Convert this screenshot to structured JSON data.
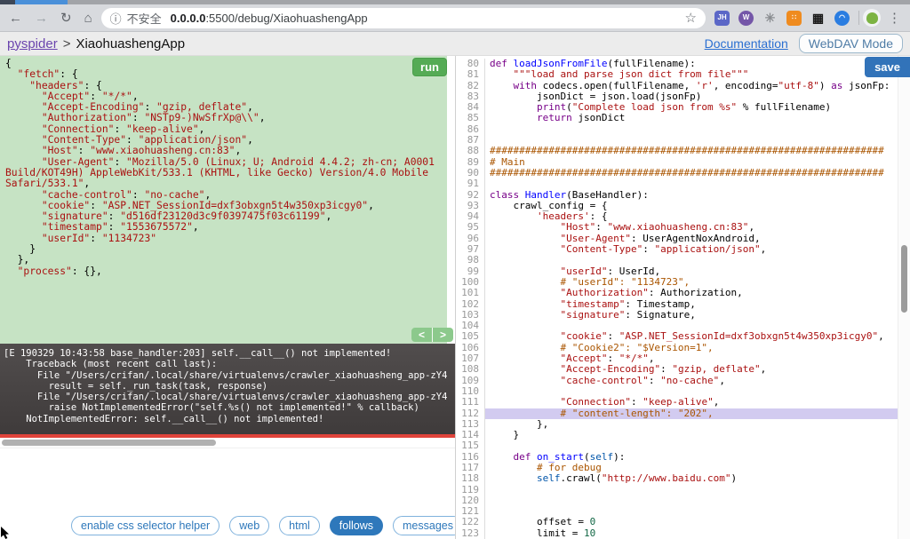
{
  "browser": {
    "icons": {
      "back": "←",
      "forward": "→",
      "reload": "↻",
      "home": "⌂",
      "info": "ⓘ",
      "star": "☆",
      "menu": "⋮"
    },
    "not_secure_label": "不安全",
    "url_host": "0.0.0.0",
    "url_path": ":5500/debug/XiaohuashengApp",
    "extensions": [
      {
        "name": "jh-extension-icon",
        "glyph": "JH",
        "bg": "#5b67c7",
        "fg": "#ffffff",
        "shape": "square"
      },
      {
        "name": "w-extension-icon",
        "glyph": "W",
        "bg": "#7456a8",
        "fg": "#ffffff",
        "shape": "circle"
      },
      {
        "name": "snowflake-extension-icon",
        "glyph": "✳",
        "bg": "transparent",
        "fg": "#8a8d91",
        "shape": "none"
      },
      {
        "name": "orange-grid-extension-icon",
        "glyph": "∷",
        "bg": "#ef8b1f",
        "fg": "#ffffff",
        "shape": "square"
      },
      {
        "name": "qr-code-extension-icon",
        "glyph": "▦",
        "bg": "transparent",
        "fg": "#1a1a1a",
        "shape": "none"
      },
      {
        "name": "blue-globe-extension-icon",
        "glyph": "◠",
        "bg": "#2a7de1",
        "fg": "#ffffff",
        "shape": "circle"
      }
    ]
  },
  "header": {
    "brand": "pyspider",
    "separator": ">",
    "project": "XiaohuashengApp",
    "doc_link": "Documentation",
    "webdav_button": "WebDAV Mode"
  },
  "task_panel": {
    "run_label": "run",
    "nav_prev": "<",
    "nav_next": ">",
    "json_text": "{\n  \"fetch\": {\n    \"headers\": {\n      \"Accept\": \"*/*\",\n      \"Accept-Encoding\": \"gzip, deflate\",\n      \"Authorization\": \"NSTp9-)NwSfrXp@\\\\\",\n      \"Connection\": \"keep-alive\",\n      \"Content-Type\": \"application/json\",\n      \"Host\": \"www.xiaohuasheng.cn:83\",\n      \"User-Agent\": \"Mozilla/5.0 (Linux; U; Android 4.4.2; zh-cn; A0001 Build/KOT49H) AppleWebKit/533.1 (KHTML, like Gecko) Version/4.0 Mobile Safari/533.1\",\n      \"cache-control\": \"no-cache\",\n      \"cookie\": \"ASP.NET_SessionId=dxf3obxgn5t4w350xp3icgy0\",\n      \"signature\": \"d516df23120d3c9f0397475f03c61199\",\n      \"timestamp\": \"1553675572\",\n      \"userId\": \"1134723\"\n    }\n  },\n  \"process\": {},"
  },
  "console": {
    "lines": [
      "[E 190329 10:43:58 base_handler:203] self.__call__() not implemented!",
      "    Traceback (most recent call last):",
      "      File \"/Users/crifan/.local/share/virtualenvs/crawler_xiaohuasheng_app-zY4",
      "        result = self._run_task(task, response)",
      "      File \"/Users/crifan/.local/share/virtualenvs/crawler_xiaohuasheng_app-zY4",
      "        raise NotImplementedError(\"self.%s() not implemented!\" % callback)",
      "    NotImplementedError: self.__call__() not implemented!"
    ]
  },
  "editor": {
    "save_label": "save",
    "first_line": 80,
    "highlight_line": 112,
    "lines": [
      [
        [
          "kw",
          "def"
        ],
        [
          "p",
          " "
        ],
        [
          "fn",
          "loadJsonFromFile"
        ],
        [
          "p",
          "(fullFilename):"
        ]
      ],
      [
        [
          "tk-str-x",
          ""
        ],
        [
          "str",
          "    \"\"\"load and parse json dict from file\"\"\""
        ]
      ],
      [
        [
          "p",
          "    "
        ],
        [
          "kw",
          "with"
        ],
        [
          "p",
          " codecs.open(fullFilename, "
        ],
        [
          "str",
          "'r'"
        ],
        [
          "p",
          ", encoding="
        ],
        [
          "str",
          "\"utf-8\""
        ],
        [
          "p",
          ") "
        ],
        [
          "kw",
          "as"
        ],
        [
          "p",
          " jsonFp:"
        ]
      ],
      [
        [
          "p",
          "        jsonDict = json.load(jsonFp)"
        ]
      ],
      [
        [
          "p",
          "        "
        ],
        [
          "kw",
          "print"
        ],
        [
          "p",
          "("
        ],
        [
          "str",
          "\"Complete load json from %s\""
        ],
        [
          "p",
          " % fullFilename)"
        ]
      ],
      [
        [
          "p",
          "        "
        ],
        [
          "kw",
          "return"
        ],
        [
          "p",
          " jsonDict"
        ]
      ],
      [],
      [],
      [
        [
          "com",
          "###################################################################"
        ]
      ],
      [
        [
          "com",
          "# Main"
        ]
      ],
      [
        [
          "com",
          "###################################################################"
        ]
      ],
      [],
      [
        [
          "kw",
          "class"
        ],
        [
          "p",
          " "
        ],
        [
          "fn",
          "Handler"
        ],
        [
          "p",
          "(BaseHandler):"
        ]
      ],
      [
        [
          "p",
          "    crawl_config = {"
        ]
      ],
      [
        [
          "p",
          "        "
        ],
        [
          "str",
          "'headers'"
        ],
        [
          "p",
          ": {"
        ]
      ],
      [
        [
          "p",
          "            "
        ],
        [
          "str",
          "\"Host\""
        ],
        [
          "p",
          ": "
        ],
        [
          "str",
          "\"www.xiaohuasheng.cn:83\""
        ],
        [
          "p",
          ","
        ]
      ],
      [
        [
          "p",
          "            "
        ],
        [
          "str",
          "\"User-Agent\""
        ],
        [
          "p",
          ": UserAgentNoxAndroid,"
        ]
      ],
      [
        [
          "p",
          "            "
        ],
        [
          "str",
          "\"Content-Type\""
        ],
        [
          "p",
          ": "
        ],
        [
          "str",
          "\"application/json\""
        ],
        [
          "p",
          ","
        ]
      ],
      [],
      [
        [
          "p",
          "            "
        ],
        [
          "str",
          "\"userId\""
        ],
        [
          "p",
          ": UserId,"
        ]
      ],
      [
        [
          "com",
          "            # \"userId\": \"1134723\","
        ]
      ],
      [
        [
          "p",
          "            "
        ],
        [
          "str",
          "\"Authorization\""
        ],
        [
          "p",
          ": Authorization,"
        ]
      ],
      [
        [
          "p",
          "            "
        ],
        [
          "str",
          "\"timestamp\""
        ],
        [
          "p",
          ": Timestamp,"
        ]
      ],
      [
        [
          "p",
          "            "
        ],
        [
          "str",
          "\"signature\""
        ],
        [
          "p",
          ": Signature,"
        ]
      ],
      [],
      [
        [
          "p",
          "            "
        ],
        [
          "str",
          "\"cookie\""
        ],
        [
          "p",
          ": "
        ],
        [
          "str",
          "\"ASP.NET_SessionId=dxf3obxgn5t4w350xp3icgy0\""
        ],
        [
          "p",
          ","
        ]
      ],
      [
        [
          "com",
          "            # \"Cookie2\": \"$Version=1\","
        ]
      ],
      [
        [
          "p",
          "            "
        ],
        [
          "str",
          "\"Accept\""
        ],
        [
          "p",
          ": "
        ],
        [
          "str",
          "\"*/*\""
        ],
        [
          "p",
          ","
        ]
      ],
      [
        [
          "p",
          "            "
        ],
        [
          "str",
          "\"Accept-Encoding\""
        ],
        [
          "p",
          ": "
        ],
        [
          "str",
          "\"gzip, deflate\""
        ],
        [
          "p",
          ","
        ]
      ],
      [
        [
          "p",
          "            "
        ],
        [
          "str",
          "\"cache-control\""
        ],
        [
          "p",
          ": "
        ],
        [
          "str",
          "\"no-cache\""
        ],
        [
          "p",
          ","
        ]
      ],
      [],
      [
        [
          "p",
          "            "
        ],
        [
          "str",
          "\"Connection\""
        ],
        [
          "p",
          ": "
        ],
        [
          "str",
          "\"keep-alive\""
        ],
        [
          "p",
          ","
        ]
      ],
      [
        [
          "com",
          "            # \"content-length\": \"202\","
        ]
      ],
      [
        [
          "p",
          "        },"
        ]
      ],
      [
        [
          "p",
          "    }"
        ]
      ],
      [],
      [
        [
          "p",
          "    "
        ],
        [
          "kw",
          "def"
        ],
        [
          "p",
          " "
        ],
        [
          "fn",
          "on_start"
        ],
        [
          "p",
          "("
        ],
        [
          "slf",
          "self"
        ],
        [
          "p",
          "):"
        ]
      ],
      [
        [
          "com",
          "        # for debug"
        ]
      ],
      [
        [
          "p",
          "        "
        ],
        [
          "slf",
          "self"
        ],
        [
          "p",
          ".crawl("
        ],
        [
          "str",
          "\"http://www.baidu.com\""
        ],
        [
          "p",
          ")"
        ]
      ],
      [],
      [],
      [],
      [
        [
          "p",
          "        offset = "
        ],
        [
          "num",
          "0"
        ]
      ],
      [
        [
          "p",
          "        limit = "
        ],
        [
          "num",
          "10"
        ]
      ]
    ]
  },
  "toolbar": {
    "buttons": [
      {
        "name": "enable-css-selector-helper-button",
        "label": "enable css selector helper",
        "active": false
      },
      {
        "name": "web-button",
        "label": "web",
        "active": false
      },
      {
        "name": "html-button",
        "label": "html",
        "active": false
      },
      {
        "name": "follows-button",
        "label": "follows",
        "active": true
      },
      {
        "name": "messages-button",
        "label": "messages",
        "active": false
      }
    ]
  },
  "colors": {
    "panel_green": "#c6e3c4",
    "run_green": "#55ab55",
    "save_blue": "#3273b9",
    "accent_blue": "#2e78bb",
    "highlight_lavender": "#d2cbf0",
    "error_red": "#e0443b",
    "string_red": "#aa1111",
    "comment_orange": "#aa5500",
    "keyword_purple": "#770088"
  }
}
